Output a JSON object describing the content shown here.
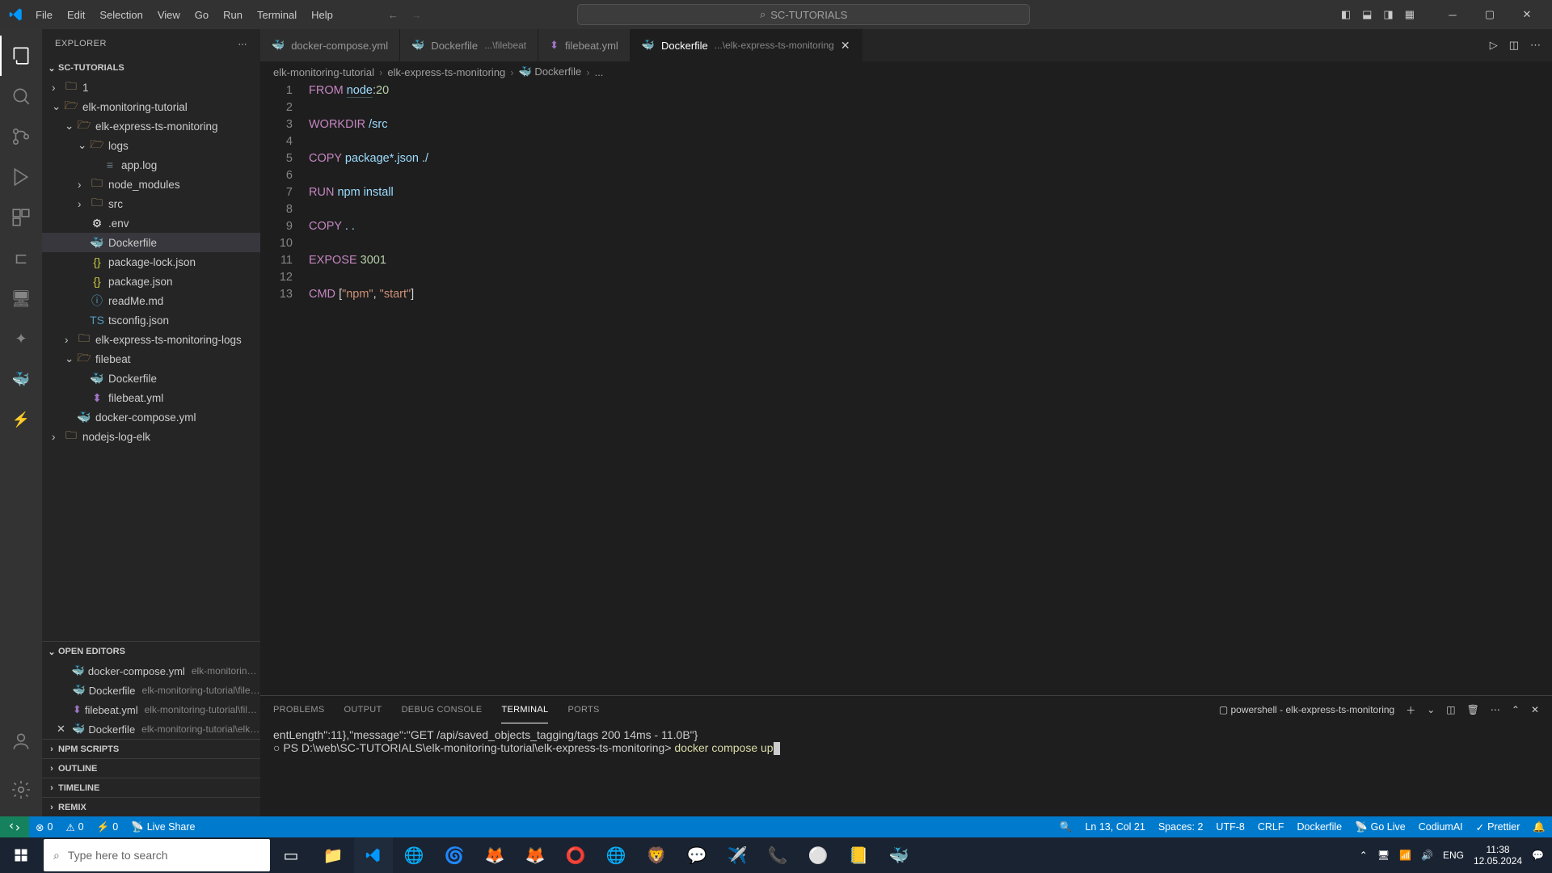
{
  "menu": [
    "File",
    "Edit",
    "Selection",
    "View",
    "Go",
    "Run",
    "Terminal",
    "Help"
  ],
  "search_placeholder": "SC-TUTORIALS",
  "sidebar": {
    "header": "EXPLORER",
    "workspace": "SC-TUTORIALS",
    "tree": [
      {
        "depth": 0,
        "icon": "folder",
        "label": "1",
        "chev": "›"
      },
      {
        "depth": 0,
        "icon": "folder-open",
        "label": "elk-monitoring-tutorial",
        "chev": "⌄"
      },
      {
        "depth": 1,
        "icon": "folder-open",
        "label": "elk-express-ts-monitoring",
        "chev": "⌄",
        "color": "#73c991"
      },
      {
        "depth": 2,
        "icon": "folder-open",
        "label": "logs",
        "chev": "⌄",
        "color": "#73c991"
      },
      {
        "depth": 3,
        "icon": "file-log",
        "label": "app.log"
      },
      {
        "depth": 2,
        "icon": "folder",
        "label": "node_modules",
        "chev": "›"
      },
      {
        "depth": 2,
        "icon": "folder",
        "label": "src",
        "chev": "›"
      },
      {
        "depth": 2,
        "icon": "file-env",
        "label": ".env"
      },
      {
        "depth": 2,
        "icon": "file-docker",
        "label": "Dockerfile",
        "selected": true
      },
      {
        "depth": 2,
        "icon": "file-json",
        "label": "package-lock.json"
      },
      {
        "depth": 2,
        "icon": "file-json",
        "label": "package.json"
      },
      {
        "depth": 2,
        "icon": "file-md",
        "label": "readMe.md"
      },
      {
        "depth": 2,
        "icon": "file-ts",
        "label": "tsconfig.json"
      },
      {
        "depth": 1,
        "icon": "folder",
        "label": "elk-express-ts-monitoring-logs",
        "chev": "›"
      },
      {
        "depth": 1,
        "icon": "folder-open",
        "label": "filebeat",
        "chev": "⌄"
      },
      {
        "depth": 2,
        "icon": "file-docker",
        "label": "Dockerfile"
      },
      {
        "depth": 2,
        "icon": "file-yml",
        "label": "filebeat.yml"
      },
      {
        "depth": 1,
        "icon": "file-docker",
        "label": "docker-compose.yml"
      },
      {
        "depth": 0,
        "icon": "folder",
        "label": "nodejs-log-elk",
        "chev": "›"
      }
    ],
    "open_editors_label": "OPEN EDITORS",
    "open_editors": [
      {
        "icon": "file-docker",
        "name": "docker-compose.yml",
        "path": "elk-monitoring-t..."
      },
      {
        "icon": "file-docker",
        "name": "Dockerfile",
        "path": "elk-monitoring-tutorial\\fileb..."
      },
      {
        "icon": "file-yml",
        "name": "filebeat.yml",
        "path": "elk-monitoring-tutorial\\file..."
      },
      {
        "icon": "file-docker",
        "name": "Dockerfile",
        "path": "elk-monitoring-tutorial\\elk-e...",
        "dirty": true
      }
    ],
    "sections": [
      "NPM SCRIPTS",
      "OUTLINE",
      "TIMELINE",
      "REMIX"
    ]
  },
  "tabs": [
    {
      "icon": "file-docker",
      "label": "docker-compose.yml",
      "path": ""
    },
    {
      "icon": "file-docker",
      "label": "Dockerfile",
      "path": "...\\filebeat"
    },
    {
      "icon": "file-yml",
      "label": "filebeat.yml",
      "path": ""
    },
    {
      "icon": "file-docker",
      "label": "Dockerfile",
      "path": "...\\elk-express-ts-monitoring",
      "active": true,
      "close": true
    }
  ],
  "breadcrumbs": [
    "elk-monitoring-tutorial",
    "elk-express-ts-monitoring",
    "Dockerfile",
    "..."
  ],
  "code_lines": [
    {
      "n": 1,
      "html": "<span class='kw'>FROM</span> <span class='id-underline'>node</span><span class='pl'>:</span><span class='num'>20</span>"
    },
    {
      "n": 2,
      "html": ""
    },
    {
      "n": 3,
      "html": "<span class='kw'>WORKDIR</span> <span class='id'>/src</span>"
    },
    {
      "n": 4,
      "html": ""
    },
    {
      "n": 5,
      "html": "<span class='kw'>COPY</span> <span class='id'>package*.json ./</span>"
    },
    {
      "n": 6,
      "html": ""
    },
    {
      "n": 7,
      "html": "<span class='kw'>RUN</span> <span class='id'>npm install</span>"
    },
    {
      "n": 8,
      "html": ""
    },
    {
      "n": 9,
      "html": "<span class='kw'>COPY</span> <span class='id'>. .</span>"
    },
    {
      "n": 10,
      "html": ""
    },
    {
      "n": 11,
      "html": "<span class='kw'>EXPOSE</span> <span class='num'>3001</span>"
    },
    {
      "n": 12,
      "html": ""
    },
    {
      "n": 13,
      "html": "<span class='kw'>CMD</span> <span class='pl'>[</span><span class='str'>\"npm\"</span><span class='pl'>, </span><span class='str'>\"start\"</span><span class='pl'>]</span>"
    }
  ],
  "panel": {
    "tabs": [
      "PROBLEMS",
      "OUTPUT",
      "DEBUG CONSOLE",
      "TERMINAL",
      "PORTS"
    ],
    "active_tab": "TERMINAL",
    "terminal_name": "powershell - elk-express-ts-monitoring",
    "lines": [
      {
        "text": "entLength\":11},\"message\":\"GET /api/saved_objects_tagging/tags 200 14ms - 11.0B\"}"
      },
      {
        "prefix": "○ PS D:\\web\\SC-TUTORIALS\\elk-monitoring-tutorial\\elk-express-ts-monitoring> ",
        "cmd": "docker compose up"
      }
    ]
  },
  "statusbar": {
    "left": [
      {
        "icon": "⊗",
        "text": "0"
      },
      {
        "icon": "⚠",
        "text": "0"
      },
      {
        "icon": "",
        "text": ""
      },
      {
        "icon": "⚡",
        "text": "0"
      },
      {
        "icon": "📡",
        "text": "Live Share"
      }
    ],
    "right": [
      {
        "text": "Ln 13, Col 21"
      },
      {
        "text": "Spaces: 2"
      },
      {
        "text": "UTF-8"
      },
      {
        "text": "CRLF"
      },
      {
        "text": "Dockerfile"
      },
      {
        "icon": "📡",
        "text": "Go Live"
      },
      {
        "text": "CodiumAI"
      },
      {
        "icon": "✓",
        "text": "Prettier"
      }
    ]
  },
  "taskbar": {
    "search_placeholder": "Type here to search",
    "lang": "ENG",
    "time": "11:38",
    "date": "12.05.2024"
  }
}
